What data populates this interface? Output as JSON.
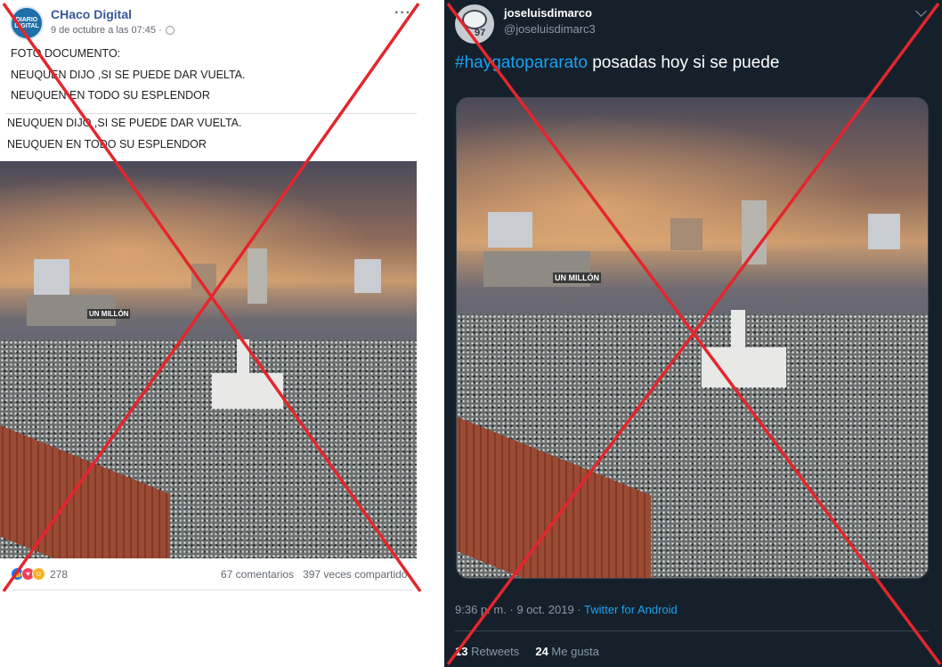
{
  "facebook": {
    "page_name": "CHaco Digital",
    "avatar_text": "DIARIO DIGITAL",
    "timestamp": "9 de octubre a las 07:45 ·",
    "more_icon": "more-horizontal-icon",
    "post_lines": [
      "FOTO DOCUMENTO:",
      "NEUQUEN DIJO ,SI SE PUEDE DAR VUELTA.",
      "NEUQUEN EN TODO SU ESPLENDOR"
    ],
    "quote_lines": [
      "NEUQUEN DIJO ,SI SE PUEDE DAR VUELTA.",
      "NEUQUEN EN TODO SU ESPLENDOR"
    ],
    "photo_banner": "UN MILLÓN",
    "reactions": [
      "like-reaction-icon",
      "love-reaction-icon",
      "haha-reaction-icon"
    ],
    "reaction_count": "278",
    "comments": "67 comentarios",
    "shares": "397 veces compartido"
  },
  "twitter": {
    "name": "joseluisdimarco",
    "handle": "@joseluisdimarc3",
    "avatar_number": "97",
    "hashtag": "#haygatopararato",
    "text": " posadas hoy si se puede",
    "photo_banner": "UN MILLÓN",
    "time": "9:36 p. m. · 9 oct. 2019 · ",
    "source": "Twitter for Android",
    "retweets_count": "13",
    "retweets_label": " Retweets",
    "likes_count": "24",
    "likes_label": " Me gusta"
  },
  "colors": {
    "facebook_link": "#385898",
    "twitter_bg": "#15202b",
    "twitter_blue": "#1da1f2",
    "x_mark": "#e3262d"
  }
}
